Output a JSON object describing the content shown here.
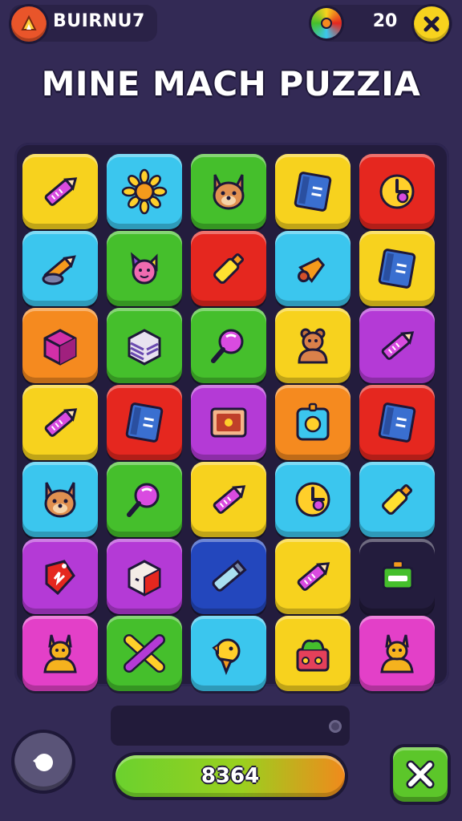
{
  "header": {
    "player_name": "BUIRNU7",
    "coin_count": "20"
  },
  "title": "MINE MACH PUZZIA",
  "colors": {
    "background": "#332a55",
    "board": "#231c3d",
    "yellow": "#f7d21e",
    "cyan": "#3bc6ee",
    "green": "#45bf2c",
    "red": "#e5271f",
    "orange": "#f58a1f",
    "purple": "#b43ad6",
    "pink": "#e340c8",
    "blue": "#2347bd"
  },
  "board": {
    "rows": [
      [
        {
          "color": "yellow",
          "icon": "crayon-icon"
        },
        {
          "color": "cyan",
          "icon": "sun-flower-icon"
        },
        {
          "color": "green",
          "icon": "kangaroo-face-icon"
        },
        {
          "color": "yellow",
          "icon": "notebook-icon"
        },
        {
          "color": "red",
          "icon": "clock-icon"
        }
      ],
      [
        {
          "color": "cyan",
          "icon": "pencil-icon"
        },
        {
          "color": "green",
          "icon": "fairy-creature-icon"
        },
        {
          "color": "red",
          "icon": "marker-icon"
        },
        {
          "color": "cyan",
          "icon": "torch-icon"
        },
        {
          "color": "yellow",
          "icon": "notebook-icon"
        }
      ],
      [
        {
          "color": "orange",
          "icon": "box-icon"
        },
        {
          "color": "green",
          "icon": "striped-box-icon"
        },
        {
          "color": "green",
          "icon": "magnifier-icon"
        },
        {
          "color": "yellow",
          "icon": "bear-icon"
        },
        {
          "color": "purple",
          "icon": "crayon-icon"
        }
      ],
      [
        {
          "color": "yellow",
          "icon": "crayon-icon"
        },
        {
          "color": "red",
          "icon": "notebook-icon"
        },
        {
          "color": "purple",
          "icon": "tablet-icon"
        },
        {
          "color": "orange",
          "icon": "badge-icon"
        },
        {
          "color": "red",
          "icon": "notebook-icon"
        }
      ],
      [
        {
          "color": "cyan",
          "icon": "kangaroo-face-icon"
        },
        {
          "color": "green",
          "icon": "magnifier-icon"
        },
        {
          "color": "yellow",
          "icon": "crayon-icon"
        },
        {
          "color": "cyan",
          "icon": "clock-icon"
        },
        {
          "color": "cyan",
          "icon": "marker-icon"
        }
      ],
      [
        {
          "color": "purple",
          "icon": "tag-icon"
        },
        {
          "color": "purple",
          "icon": "gift-box-icon"
        },
        {
          "color": "blue",
          "icon": "tube-icon"
        },
        {
          "color": "yellow",
          "icon": "crayon-icon"
        },
        {
          "color": "board",
          "icon": "battery-icon"
        }
      ],
      [
        {
          "color": "pink",
          "icon": "kangaroo-icon"
        },
        {
          "color": "green",
          "icon": "crossed-crayons-icon"
        },
        {
          "color": "cyan",
          "icon": "bird-icon"
        },
        {
          "color": "yellow",
          "icon": "toy-box-icon"
        },
        {
          "color": "pink",
          "icon": "kangaroo-icon"
        }
      ]
    ]
  },
  "footer": {
    "score": "8364",
    "score_progress": 1.0
  }
}
